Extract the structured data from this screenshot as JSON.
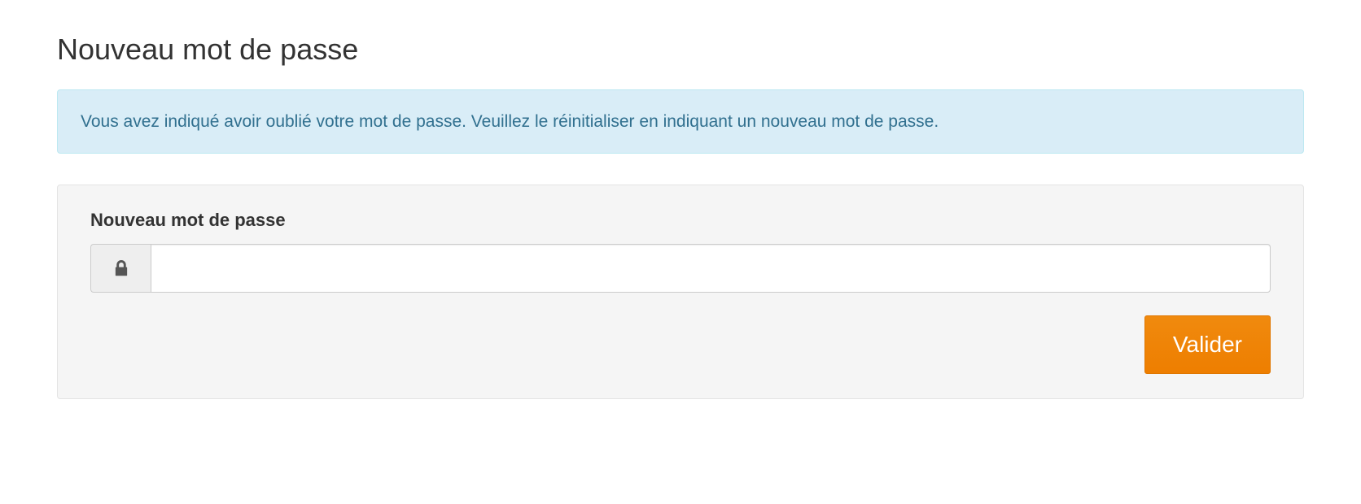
{
  "page": {
    "title": "Nouveau mot de passe"
  },
  "alert": {
    "message": "Vous avez indiqué avoir oublié votre mot de passe. Veuillez le réinitialiser en indiquant un nouveau mot de passe."
  },
  "form": {
    "password_label": "Nouveau mot de passe",
    "password_value": "",
    "submit_label": "Valider"
  }
}
